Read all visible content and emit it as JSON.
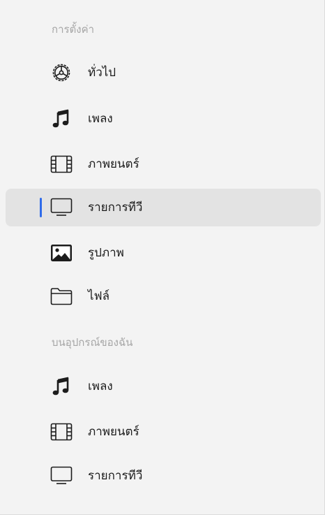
{
  "sidebar": {
    "settings_header": "การตั้งค่า",
    "settings_items": [
      {
        "label": "ทั่วไป",
        "icon": "gear-icon"
      },
      {
        "label": "เพลง",
        "icon": "music-note-icon"
      },
      {
        "label": "ภาพยนตร์",
        "icon": "film-icon"
      },
      {
        "label": "รายการทีวี",
        "icon": "tv-icon",
        "selected": true
      },
      {
        "label": "รูปภาพ",
        "icon": "photo-icon"
      },
      {
        "label": "ไฟล์",
        "icon": "folder-icon"
      }
    ],
    "device_header": "บนอุปกรณ์ของฉัน",
    "device_items": [
      {
        "label": "เพลง",
        "icon": "music-note-icon"
      },
      {
        "label": "ภาพยนตร์",
        "icon": "film-icon"
      },
      {
        "label": "รายการทีวี",
        "icon": "tv-icon"
      }
    ],
    "colors": {
      "selection_indicator": "#2f6bea",
      "selected_background": "#e3e3e3",
      "background": "#f3f3f3"
    }
  }
}
